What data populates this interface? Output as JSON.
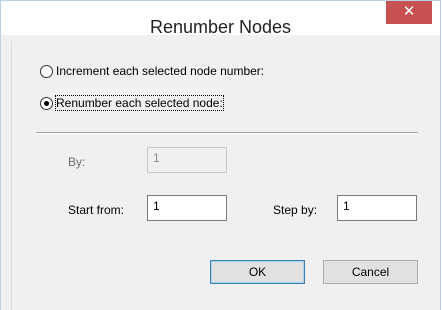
{
  "dialog": {
    "title": "Renumber Nodes",
    "close_glyph": "✕"
  },
  "mode": {
    "options": [
      {
        "label": "Increment each selected node number:",
        "selected": false
      },
      {
        "label": "Renumber each selected node:",
        "selected": true
      }
    ]
  },
  "fields": {
    "by_label": "By:",
    "by_value": "1",
    "start_from_label": "Start from:",
    "start_from_value": "1",
    "step_by_label": "Step by:",
    "step_by_value": "1"
  },
  "buttons": {
    "ok_label": "OK",
    "cancel_label": "Cancel"
  },
  "colors": {
    "close_button": "#c75050",
    "dialog_background": "#f0f0f0",
    "default_button_border": "#3c7fb1"
  },
  "icons": {
    "close": "close-icon"
  }
}
